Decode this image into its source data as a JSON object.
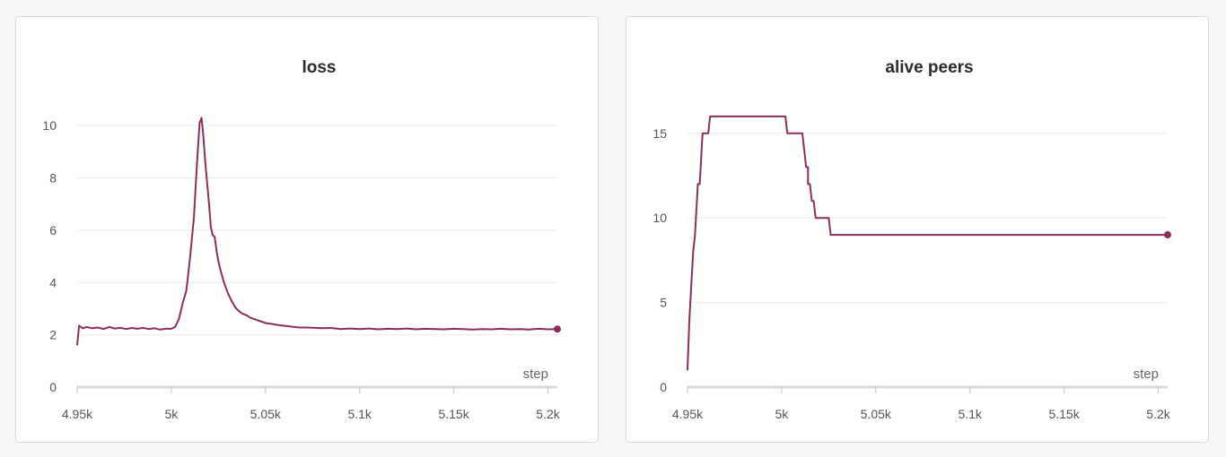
{
  "colors": {
    "series": "#8b2e5f",
    "background": "#f7f7f7",
    "panel": "#ffffff"
  },
  "chart_data": [
    {
      "type": "line",
      "title": "loss",
      "xlabel": "step",
      "ylabel": "",
      "xlim": [
        4950,
        5205
      ],
      "ylim": [
        0,
        11
      ],
      "grid": true,
      "x_ticks": [
        4950,
        5000,
        5050,
        5100,
        5150,
        5200
      ],
      "x_tick_labels": [
        "4.95k",
        "5k",
        "5.05k",
        "5.1k",
        "5.15k",
        "5.2k"
      ],
      "y_ticks": [
        0,
        2,
        4,
        6,
        8,
        10
      ],
      "y_tick_labels": [
        "0",
        "2",
        "4",
        "6",
        "8",
        "10"
      ],
      "series": [
        {
          "color": "#8b2e5f",
          "end_marker": true,
          "x": [
            4950,
            4951,
            4953,
            4955,
            4958,
            4961,
            4964,
            4967,
            4970,
            4973,
            4976,
            4979,
            4982,
            4985,
            4988,
            4991,
            4994,
            4997,
            5000,
            5002,
            5004,
            5006,
            5008,
            5010,
            5012,
            5013,
            5014,
            5015,
            5016,
            5017,
            5018,
            5019,
            5020,
            5021,
            5022,
            5023,
            5024,
            5025,
            5026,
            5027,
            5028,
            5030,
            5032,
            5034,
            5036,
            5038,
            5040,
            5042,
            5044,
            5046,
            5048,
            5050,
            5053,
            5056,
            5059,
            5062,
            5065,
            5068,
            5071,
            5075,
            5080,
            5085,
            5090,
            5095,
            5100,
            5105,
            5110,
            5115,
            5120,
            5125,
            5130,
            5135,
            5140,
            5145,
            5150,
            5155,
            5160,
            5165,
            5170,
            5175,
            5180,
            5185,
            5190,
            5195,
            5200,
            5205
          ],
          "y": [
            1.6,
            2.35,
            2.25,
            2.3,
            2.25,
            2.28,
            2.22,
            2.3,
            2.24,
            2.27,
            2.22,
            2.26,
            2.23,
            2.27,
            2.22,
            2.25,
            2.2,
            2.23,
            2.23,
            2.3,
            2.6,
            3.2,
            3.7,
            5.0,
            6.5,
            7.8,
            9.0,
            10.1,
            10.3,
            9.6,
            8.6,
            7.8,
            7.0,
            6.1,
            5.8,
            5.75,
            5.2,
            4.8,
            4.5,
            4.25,
            4.0,
            3.6,
            3.3,
            3.05,
            2.9,
            2.8,
            2.75,
            2.65,
            2.6,
            2.55,
            2.5,
            2.45,
            2.42,
            2.38,
            2.35,
            2.33,
            2.3,
            2.28,
            2.28,
            2.27,
            2.25,
            2.26,
            2.22,
            2.24,
            2.22,
            2.24,
            2.21,
            2.23,
            2.22,
            2.24,
            2.21,
            2.23,
            2.22,
            2.21,
            2.23,
            2.22,
            2.2,
            2.22,
            2.21,
            2.23,
            2.21,
            2.22,
            2.2,
            2.23,
            2.21,
            2.22
          ]
        }
      ]
    },
    {
      "type": "line",
      "title": "alive peers",
      "xlabel": "step",
      "ylabel": "",
      "xlim": [
        4950,
        5205
      ],
      "ylim": [
        0,
        17
      ],
      "grid": true,
      "x_ticks": [
        4950,
        5000,
        5050,
        5100,
        5150,
        5200
      ],
      "x_tick_labels": [
        "4.95k",
        "5k",
        "5.05k",
        "5.1k",
        "5.15k",
        "5.2k"
      ],
      "y_ticks": [
        0,
        5,
        10,
        15
      ],
      "y_tick_labels": [
        "0",
        "5",
        "10",
        "15"
      ],
      "series": [
        {
          "color": "#8b2e5f",
          "end_marker": true,
          "x": [
            4950,
            4951,
            4952,
            4953,
            4954,
            4954.5,
            4955,
            4955.5,
            4956,
            4956.5,
            4957,
            4957.5,
            4958,
            4959,
            4959,
            4960,
            4961,
            4962,
            4962,
            5002,
            5003,
            5003,
            5011,
            5012,
            5012,
            5013,
            5014,
            5014,
            5015,
            5016,
            5016,
            5017,
            5018,
            5018,
            5019,
            5021,
            5021,
            5025,
            5026,
            5026,
            5205
          ],
          "y": [
            1,
            4,
            6,
            8,
            9,
            10,
            11,
            12,
            12,
            12,
            13,
            14,
            15,
            15,
            15,
            15,
            15,
            16,
            16,
            16,
            15,
            15,
            15,
            14,
            14,
            13,
            13,
            12,
            12,
            11,
            11,
            11,
            10,
            10,
            10,
            10,
            10,
            10,
            9,
            9,
            9
          ]
        }
      ]
    }
  ]
}
